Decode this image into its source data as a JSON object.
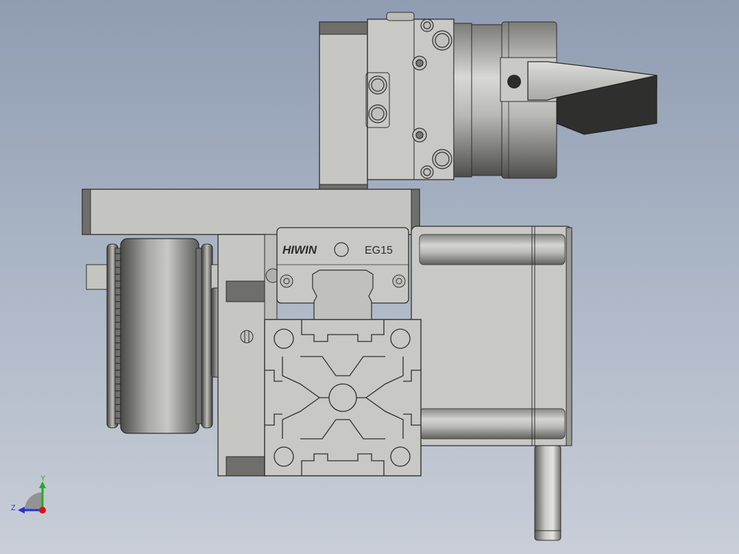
{
  "viewport": {
    "background_top": "#8f9cb2",
    "background_bottom": "#c9ced8",
    "part_color": "#c4c4c0",
    "dark_color": "#2f302d"
  },
  "rail_block": {
    "brand": "HIWIN",
    "model": "EG15"
  },
  "triad": {
    "y_label": "Y",
    "z_label": "Z",
    "y_color": "#22aa22",
    "z_color": "#2233cc",
    "origin_color": "#dd1111"
  }
}
